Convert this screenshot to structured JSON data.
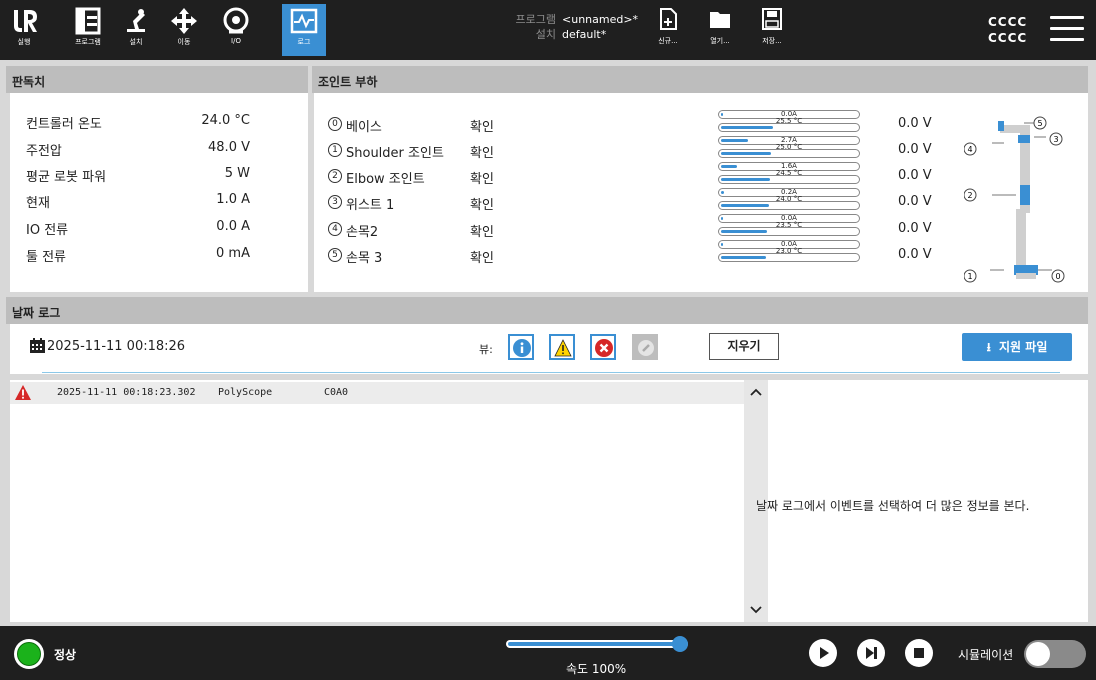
{
  "nav": {
    "items": [
      {
        "label": "실행",
        "icon": "ur-logo-icon"
      },
      {
        "label": "프로그램",
        "icon": "program-icon"
      },
      {
        "label": "설치",
        "icon": "installation-icon"
      },
      {
        "label": "이동",
        "icon": "move-icon"
      },
      {
        "label": "I/O",
        "icon": "io-icon"
      },
      {
        "label": "로그",
        "icon": "log-icon",
        "active": true
      }
    ]
  },
  "program": {
    "program_key": "프로그램",
    "program_value": "<unnamed>*",
    "install_key": "설치",
    "install_value": "default*"
  },
  "file_actions": {
    "new": "신규...",
    "open": "열기...",
    "save": "저장..."
  },
  "user": {
    "line1": "CCCC",
    "line2": "CCCC"
  },
  "readings": {
    "title": "판독치",
    "rows": [
      {
        "label": "컨트롤러 온도",
        "value": "24.0 °C"
      },
      {
        "label": "주전압",
        "value": "48.0 V"
      },
      {
        "label": "평균 로봇 파워",
        "value": "5 W"
      },
      {
        "label": "현재",
        "value": "1.0 A"
      },
      {
        "label": "IO 전류",
        "value": "0.0 A"
      },
      {
        "label": "툴 전류",
        "value": "0 mA"
      }
    ]
  },
  "joint_load": {
    "title": "조인트 부하",
    "joints": [
      {
        "num": "0",
        "name": "베이스",
        "status": "확인",
        "current": "0.0A",
        "temp": "25.5 °C",
        "voltage": "0.0 V",
        "current_frac": 0.0,
        "temp_frac": 0.38
      },
      {
        "num": "1",
        "name": "Shoulder 조인트",
        "status": "확인",
        "current": "2.7A",
        "temp": "25.0 °C",
        "voltage": "0.0 V",
        "current_frac": 0.2,
        "temp_frac": 0.37
      },
      {
        "num": "2",
        "name": "Elbow 조인트",
        "status": "확인",
        "current": "1.6A",
        "temp": "24.5 °C",
        "voltage": "0.0 V",
        "current_frac": 0.12,
        "temp_frac": 0.36
      },
      {
        "num": "3",
        "name": "위스트 1",
        "status": "확인",
        "current": "0.2A",
        "temp": "24.0 °C",
        "voltage": "0.0 V",
        "current_frac": 0.02,
        "temp_frac": 0.35
      },
      {
        "num": "4",
        "name": "손목2",
        "status": "확인",
        "current": "0.0A",
        "temp": "23.5 °C",
        "voltage": "0.0 V",
        "current_frac": 0.0,
        "temp_frac": 0.34
      },
      {
        "num": "5",
        "name": "손목 3",
        "status": "확인",
        "current": "0.0A",
        "temp": "23.0 °C",
        "voltage": "0.0 V",
        "current_frac": 0.0,
        "temp_frac": 0.33
      }
    ],
    "diagram_labels": [
      "5",
      "3",
      "4",
      "2",
      "1",
      "0"
    ]
  },
  "date_log": {
    "title": "날짜 로그",
    "timestamp": "2025-11-11 00:18:26",
    "view_label": "뷰:",
    "clear_label": "지우기",
    "support_label": "지원 파일",
    "entries": [
      {
        "level": "warning",
        "time": "2025-11-11 00:18:23.302",
        "source": "PolyScope",
        "code": "C0A0"
      }
    ],
    "detail_hint": "날짜 로그에서 이벤트를 선택하여 더 많은 정보를 본다."
  },
  "bottom": {
    "status": "정상",
    "speed_label": "속도 100%",
    "speed_value": 100,
    "simulation_label": "시뮬레이션"
  }
}
